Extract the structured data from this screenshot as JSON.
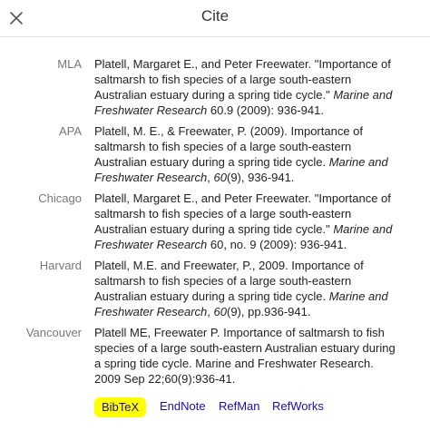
{
  "dialog": {
    "title": "Cite",
    "close_icon": "close-icon"
  },
  "citations": [
    {
      "style": "MLA",
      "parts": [
        {
          "text": "Platell, Margaret E., and Peter Freewater. \"Importance of saltmarsh to fish species of a large south-eastern Australian estuary during a spring tide cycle.\" ",
          "italic": false
        },
        {
          "text": "Marine and Freshwater Research",
          "italic": true
        },
        {
          "text": " 60.9 (2009): 936-941.",
          "italic": false
        }
      ]
    },
    {
      "style": "APA",
      "parts": [
        {
          "text": "Platell, M. E., & Freewater, P. (2009). Importance of saltmarsh to fish species of a large south-eastern Australian estuary during a spring tide cycle. ",
          "italic": false
        },
        {
          "text": "Marine and Freshwater Research",
          "italic": true
        },
        {
          "text": ", ",
          "italic": false
        },
        {
          "text": "60",
          "italic": true
        },
        {
          "text": "(9), 936-941.",
          "italic": false
        }
      ]
    },
    {
      "style": "Chicago",
      "parts": [
        {
          "text": "Platell, Margaret E., and Peter Freewater. \"Importance of saltmarsh to fish species of a large south-eastern Australian estuary during a spring tide cycle.\" ",
          "italic": false
        },
        {
          "text": "Marine and Freshwater Research",
          "italic": true
        },
        {
          "text": " 60, no. 9 (2009): 936-941.",
          "italic": false
        }
      ]
    },
    {
      "style": "Harvard",
      "parts": [
        {
          "text": "Platell, M.E. and Freewater, P., 2009. Importance of saltmarsh to fish species of a large south-eastern Australian estuary during a spring tide cycle. ",
          "italic": false
        },
        {
          "text": "Marine and Freshwater Research",
          "italic": true
        },
        {
          "text": ", ",
          "italic": false
        },
        {
          "text": "60",
          "italic": true
        },
        {
          "text": "(9), pp.936-941.",
          "italic": false
        }
      ]
    },
    {
      "style": "Vancouver",
      "parts": [
        {
          "text": "Platell ME, Freewater P. Importance of saltmarsh to fish species of a large south-eastern Australian estuary during a spring tide cycle. Marine and Freshwater Research. 2009 Sep 22;60(9):936-41.",
          "italic": false
        }
      ]
    }
  ],
  "export_links": {
    "bibtex": "BibTeX",
    "endnote": "EndNote",
    "refman": "RefMan",
    "refworks": "RefWorks"
  },
  "colors": {
    "link": "#1a0dab",
    "highlight": "#ffff00",
    "label": "#777777"
  }
}
